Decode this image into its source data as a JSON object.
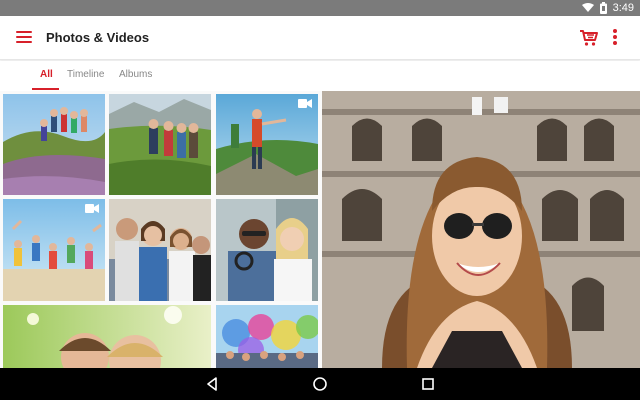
{
  "status_bar": {
    "time": "3:49",
    "icons": [
      "wifi-icon",
      "battery-icon"
    ]
  },
  "app_bar": {
    "title": "Photos & Videos",
    "menu_icon": "hamburger-menu-icon",
    "cart_icon": "shopping-cart-icon",
    "more_icon": "more-vertical-icon"
  },
  "tabs": [
    {
      "label": "All",
      "active": true
    },
    {
      "label": "Timeline",
      "active": false
    },
    {
      "label": "Albums",
      "active": false
    }
  ],
  "tiles": [
    {
      "subject": "group of hikers on a grassy hill",
      "is_video": false
    },
    {
      "subject": "group of friends on a mountain trail",
      "is_video": false
    },
    {
      "subject": "hiker pointing at a valley",
      "is_video": true
    },
    {
      "subject": "friends jumping on a beach",
      "is_video": true
    },
    {
      "subject": "group selfie of friends",
      "is_video": false
    },
    {
      "subject": "couple smiling outdoors",
      "is_video": false
    },
    {
      "subject": "children smiling in a park",
      "is_video": false
    },
    {
      "subject": "color festival crowd",
      "is_video": false
    }
  ],
  "featured": {
    "subject": "smiling woman with sunglasses in front of the Colosseum"
  },
  "nav_bar": {
    "icons": [
      "back-icon",
      "home-icon",
      "recents-icon"
    ]
  },
  "colors": {
    "accent": "#d7202a",
    "status_bar": "#7b7b7b",
    "nav_bar": "#000000"
  }
}
